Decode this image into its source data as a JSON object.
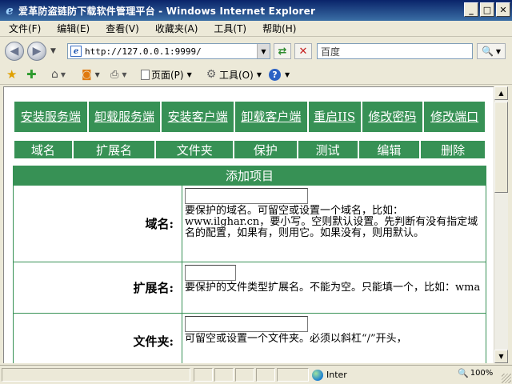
{
  "window": {
    "title": "爱革防盗链防下载软件管理平台 - Windows Internet Explorer"
  },
  "menu": [
    {
      "label": "文件(F)"
    },
    {
      "label": "编辑(E)"
    },
    {
      "label": "查看(V)"
    },
    {
      "label": "收藏夹(A)"
    },
    {
      "label": "工具(T)"
    },
    {
      "label": "帮助(H)"
    }
  ],
  "address": {
    "url": "http://127.0.0.1:9999/"
  },
  "search": {
    "placeholder": "百度"
  },
  "commands": {
    "page": "页面(P)",
    "tools": "工具(O)"
  },
  "nav": [
    {
      "label": "安装服务端"
    },
    {
      "label": "卸载服务端"
    },
    {
      "label": "安装客户端"
    },
    {
      "label": "卸载客户端"
    },
    {
      "label": "重启IIS"
    },
    {
      "label": "修改密码"
    },
    {
      "label": "修改端口"
    }
  ],
  "ops": [
    {
      "label": "域名"
    },
    {
      "label": "扩展名"
    },
    {
      "label": "文件夹"
    },
    {
      "label": "保护"
    },
    {
      "label": "测试"
    },
    {
      "label": "编辑"
    },
    {
      "label": "删除"
    }
  ],
  "form": {
    "title": "添加项目",
    "rows": [
      {
        "label": "域名:",
        "help": "要保护的域名。可留空或设置一个域名，比如：www.ilghar.cn，要小写。空则默认设置。先判断有没有指定域名的配置，如果有，则用它。如果没有，则用默认。"
      },
      {
        "label": "扩展名:",
        "help": "要保护的文件类型扩展名。不能为空。只能填一个，比如：wma"
      },
      {
        "label": "文件夹:",
        "help": "可留空或设置一个文件夹。必须以斜杠“/”开头，"
      }
    ]
  },
  "status": {
    "zone": "Inter",
    "zoom": "100%"
  }
}
